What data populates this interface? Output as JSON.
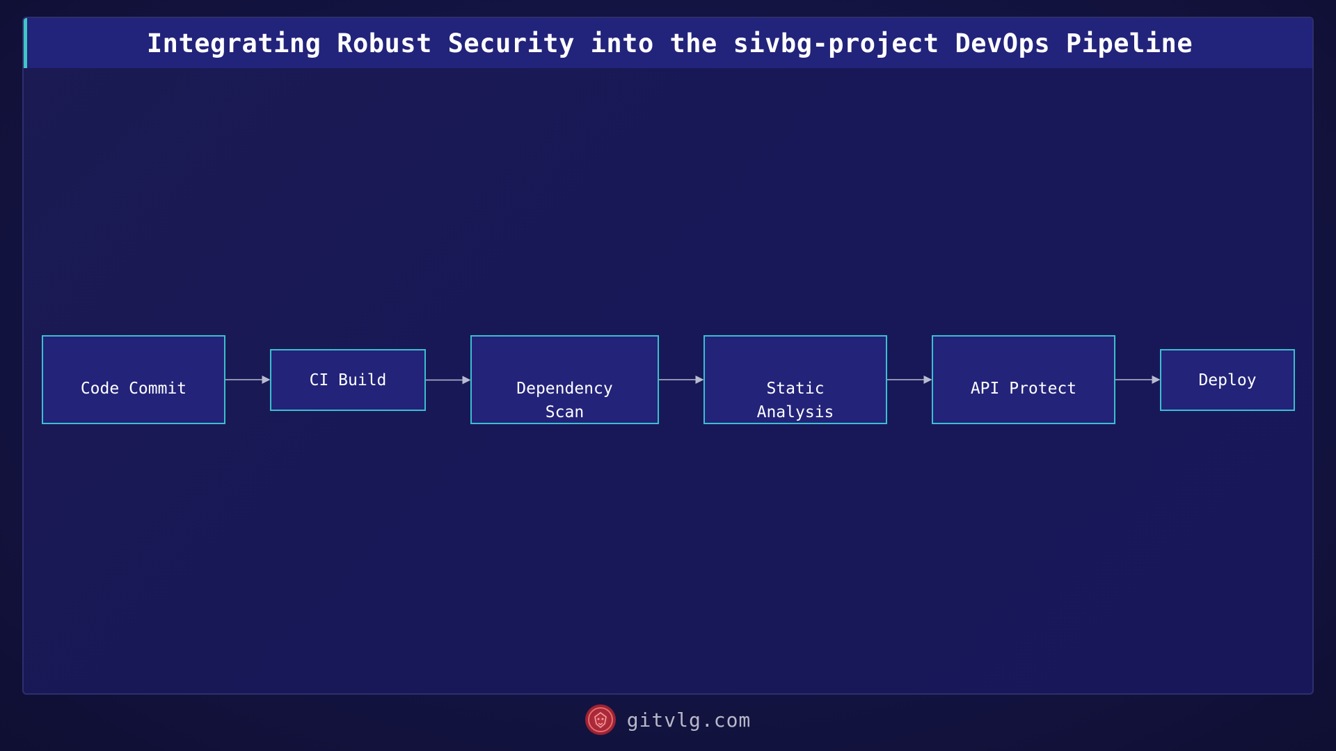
{
  "header": {
    "title": "Integrating Robust Security into the sivbg-project DevOps Pipeline"
  },
  "diagram": {
    "nodes": [
      {
        "id": "code-commit",
        "label": "Code Commit"
      },
      {
        "id": "ci-build",
        "label": "CI Build"
      },
      {
        "id": "dependency-scan",
        "label": "Dependency\nScan"
      },
      {
        "id": "static-analysis",
        "label": "Static\nAnalysis"
      },
      {
        "id": "api-protect",
        "label": "API Protect"
      },
      {
        "id": "deploy",
        "label": "Deploy"
      }
    ],
    "edges": [
      {
        "from": "code-commit",
        "to": "ci-build"
      },
      {
        "from": "ci-build",
        "to": "dependency-scan"
      },
      {
        "from": "dependency-scan",
        "to": "static-analysis"
      },
      {
        "from": "static-analysis",
        "to": "api-protect"
      },
      {
        "from": "api-protect",
        "to": "deploy"
      }
    ],
    "colors": {
      "node_fill": "#23237a",
      "node_border": "#3bbfcf",
      "edge": "#b9bcd0",
      "accent": "#3fc6c6"
    }
  },
  "footer": {
    "site": "gitvlg.com",
    "logo_icon": "lion-icon"
  }
}
